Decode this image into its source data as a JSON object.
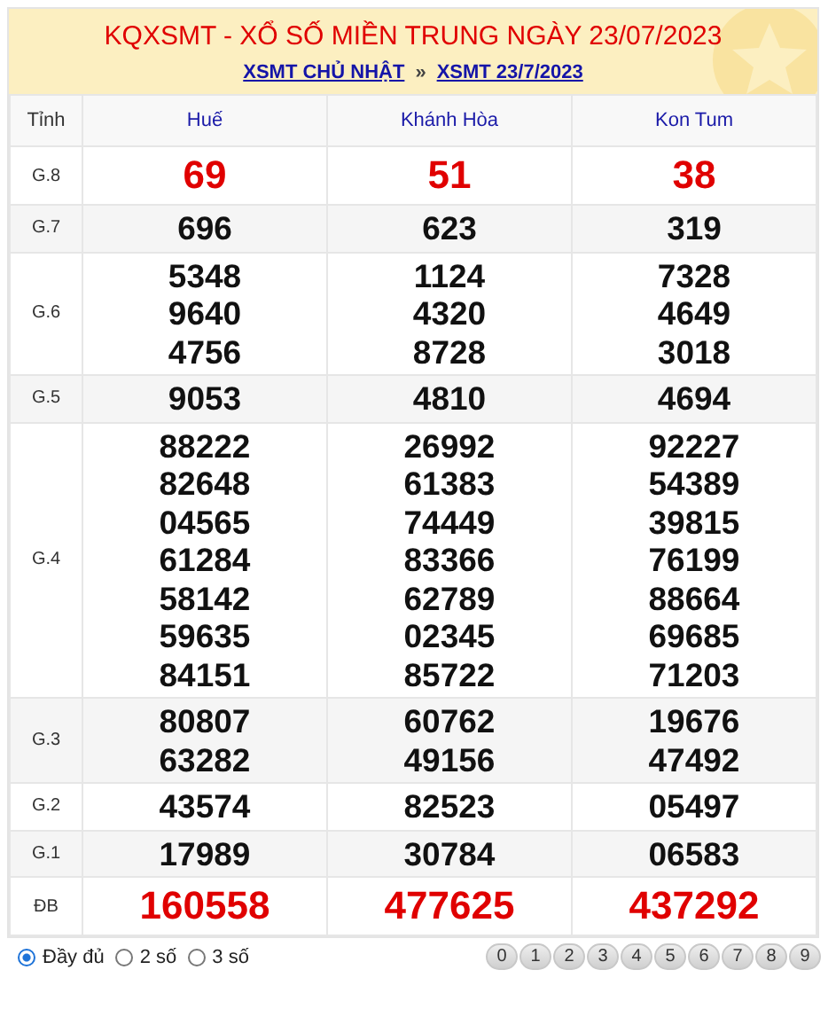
{
  "header": {
    "title": "KQXSMT - XỔ SỐ MIỀN TRUNG NGÀY 23/07/2023",
    "breadcrumb": [
      {
        "label": "XSMT CHỦ NHẬT"
      },
      {
        "label": "XSMT 23/7/2023"
      }
    ],
    "separator": "»"
  },
  "table": {
    "columns": [
      "Tỉnh",
      "Huế",
      "Khánh Hòa",
      "Kon Tum"
    ],
    "rows": [
      {
        "kind": "highlight",
        "cells": [
          [
            "G.8"
          ],
          [
            "69"
          ],
          [
            "51"
          ],
          [
            "38"
          ]
        ]
      },
      {
        "kind": "normal",
        "cells": [
          [
            "G.7"
          ],
          [
            "696"
          ],
          [
            "623"
          ],
          [
            "319"
          ]
        ]
      },
      {
        "kind": "normal",
        "cells": [
          [
            "G.6"
          ],
          [
            "5348",
            "9640",
            "4756"
          ],
          [
            "1124",
            "4320",
            "8728"
          ],
          [
            "7328",
            "4649",
            "3018"
          ]
        ]
      },
      {
        "kind": "normal",
        "cells": [
          [
            "G.5"
          ],
          [
            "9053"
          ],
          [
            "4810"
          ],
          [
            "4694"
          ]
        ]
      },
      {
        "kind": "normal",
        "cells": [
          [
            "G.4"
          ],
          [
            "88222",
            "82648",
            "04565",
            "61284",
            "58142",
            "59635",
            "84151"
          ],
          [
            "26992",
            "61383",
            "74449",
            "83366",
            "62789",
            "02345",
            "85722"
          ],
          [
            "92227",
            "54389",
            "39815",
            "76199",
            "88664",
            "69685",
            "71203"
          ]
        ]
      },
      {
        "kind": "normal",
        "cells": [
          [
            "G.3"
          ],
          [
            "80807",
            "63282"
          ],
          [
            "60762",
            "49156"
          ],
          [
            "19676",
            "47492"
          ]
        ]
      },
      {
        "kind": "normal",
        "cells": [
          [
            "G.2"
          ],
          [
            "43574"
          ],
          [
            "82523"
          ],
          [
            "05497"
          ]
        ]
      },
      {
        "kind": "normal",
        "cells": [
          [
            "G.1"
          ],
          [
            "17989"
          ],
          [
            "30784"
          ],
          [
            "06583"
          ]
        ]
      },
      {
        "kind": "highlight",
        "cells": [
          [
            "ĐB"
          ],
          [
            "160558"
          ],
          [
            "477625"
          ],
          [
            "437292"
          ]
        ]
      }
    ]
  },
  "filters": [
    {
      "label": "Đầy đủ",
      "selected": true
    },
    {
      "label": "2 số",
      "selected": false
    },
    {
      "label": "3 số",
      "selected": false
    }
  ],
  "digits": [
    "0",
    "1",
    "2",
    "3",
    "4",
    "5",
    "6",
    "7",
    "8",
    "9"
  ]
}
